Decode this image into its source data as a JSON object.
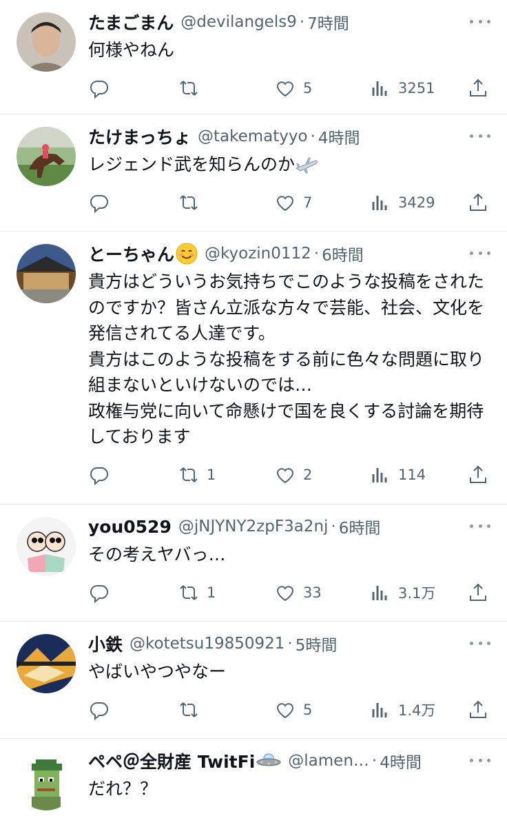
{
  "tweets": [
    {
      "name": "たまごまん",
      "handle": "@devilangels9",
      "time": "7時間",
      "text": "何様やねん",
      "replies": "",
      "retweets": "",
      "likes": "5",
      "views": "3251"
    },
    {
      "name": "たけまっちょ",
      "handle": "@takematyyo",
      "time": "4時間",
      "text": "レジェンド武を知らんのか",
      "text_emoji": "airplane",
      "replies": "",
      "retweets": "",
      "likes": "7",
      "views": "3429"
    },
    {
      "name": "とーちゃん",
      "name_emoji": "smiling-face",
      "handle": "@kyozin0112",
      "time": "6時間",
      "text": "貴方はどういうお気持ちでこのような投稿をされたのですか？皆さん立派な方々で芸能、社会、文化を発信されてる人達です。\n貴方はこのような投稿をする前に色々な問題に取り組まないといけないのでは…\n政権与党に向いて命懸けで国を良くする討論を期待しております",
      "replies": "",
      "retweets": "1",
      "likes": "2",
      "views": "114"
    },
    {
      "name": "you0529",
      "handle": "@jNJYNY2zpF3a2nj",
      "time": "6時間",
      "text": "その考えヤバっ…",
      "replies": "",
      "retweets": "1",
      "likes": "33",
      "views": "3.1万"
    },
    {
      "name": "小鉄",
      "handle": "@kotetsu19850921",
      "time": "5時間",
      "text": "やばいやつやなー",
      "replies": "",
      "retweets": "",
      "likes": "5",
      "views": "1.4万"
    },
    {
      "name": "ペペ＠全財産 TwitFi",
      "name_emoji": "flying-saucer",
      "handle": "@lamen…",
      "time": "4時間",
      "text": "だれ？？"
    }
  ],
  "separator": "·",
  "colors": {
    "text": "#0f1419",
    "secondary": "#536471",
    "divider": "#e6e9ec"
  },
  "icons": [
    "reply-icon",
    "retweet-icon",
    "like-icon",
    "views-icon",
    "share-icon",
    "more-icon"
  ]
}
